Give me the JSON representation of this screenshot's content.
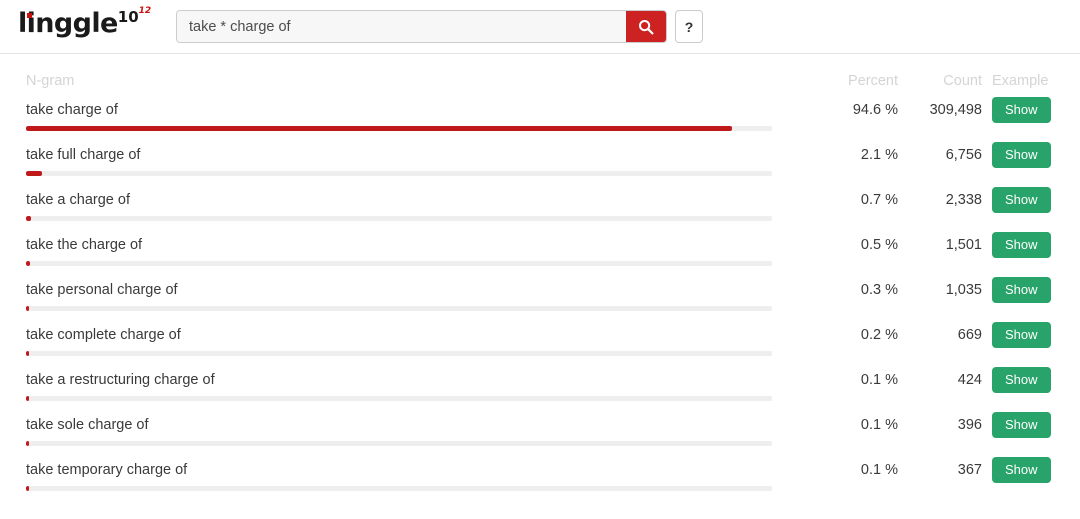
{
  "header": {
    "logo": {
      "word": "linggle",
      "sup_main": "10",
      "sup_small": "12"
    },
    "search": {
      "value": "take * charge of",
      "placeholder": "",
      "search_icon": "search-icon",
      "help_label": "?"
    }
  },
  "colors": {
    "accent_red": "#c0191c",
    "search_button_red": "#cc2222",
    "show_button_green": "#28a36a",
    "bar_track_gray": "#eeeeee",
    "header_text_gray": "#d4d4d4"
  },
  "table": {
    "columns": {
      "ngram": "N-gram",
      "percent": "Percent",
      "count": "Count",
      "example": "Example"
    },
    "show_label": "Show",
    "rows": [
      {
        "ngram": "take charge of",
        "percent": "94.6 %",
        "count": "309,498",
        "bar": 94.6,
        "show": "Show"
      },
      {
        "ngram": "take full charge of",
        "percent": "2.1 %",
        "count": "6,756",
        "bar": 2.1,
        "show": "Show"
      },
      {
        "ngram": "take a charge of",
        "percent": "0.7 %",
        "count": "2,338",
        "bar": 0.7,
        "show": "Show"
      },
      {
        "ngram": "take the charge of",
        "percent": "0.5 %",
        "count": "1,501",
        "bar": 0.5,
        "show": "Show"
      },
      {
        "ngram": "take personal charge of",
        "percent": "0.3 %",
        "count": "1,035",
        "bar": 0.3,
        "show": "Show"
      },
      {
        "ngram": "take complete charge of",
        "percent": "0.2 %",
        "count": "669",
        "bar": 0.2,
        "show": "Show"
      },
      {
        "ngram": "take a restructuring charge of",
        "percent": "0.1 %",
        "count": "424",
        "bar": 0.14,
        "show": "Show"
      },
      {
        "ngram": "take sole charge of",
        "percent": "0.1 %",
        "count": "396",
        "bar": 0.12,
        "show": "Show"
      },
      {
        "ngram": "take temporary charge of",
        "percent": "0.1 %",
        "count": "367",
        "bar": 0.11,
        "show": "Show"
      }
    ]
  },
  "chart_data": {
    "type": "bar",
    "title": "N-gram frequency distribution for \"take * charge of\"",
    "categories": [
      "take charge of",
      "take full charge of",
      "take a charge of",
      "take the charge of",
      "take personal charge of",
      "take complete charge of",
      "take a restructuring charge of",
      "take sole charge of",
      "take temporary charge of"
    ],
    "values": [
      94.6,
      2.1,
      0.7,
      0.5,
      0.3,
      0.2,
      0.1,
      0.1,
      0.1
    ],
    "counts": [
      309498,
      6756,
      2338,
      1501,
      1035,
      669,
      424,
      396,
      367
    ],
    "xlabel": "Percent",
    "ylabel": "N-gram",
    "xlim": [
      0,
      100
    ],
    "grid": false,
    "legend": "none"
  }
}
